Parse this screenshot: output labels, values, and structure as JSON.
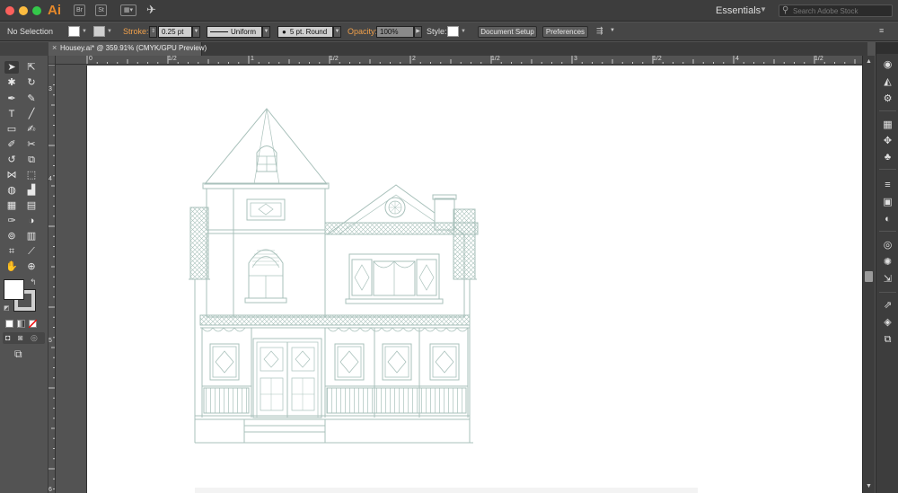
{
  "app": {
    "logo": "Ai",
    "workspace": "Essentials",
    "search_placeholder": "Search Adobe Stock"
  },
  "control_bar": {
    "selection": "No Selection",
    "stroke_label": "Stroke:",
    "stroke_weight": "0.25 pt",
    "profile": "Uniform",
    "brush": "5 pt. Round",
    "opacity_label": "Opacity:",
    "opacity": "100%",
    "style_label": "Style:",
    "document_setup": "Document Setup",
    "preferences": "Preferences"
  },
  "document": {
    "tab_title": "Housey.ai* @ 359.91% (CMYK/GPU Preview)"
  },
  "rulers": {
    "top": [
      "0",
      "1/2",
      "1",
      "1/2",
      "2",
      "1/2",
      "3",
      "1/2",
      "4",
      "1/2"
    ],
    "left": [
      "3",
      "4",
      "5",
      "6"
    ]
  },
  "colors": {
    "accent": "#f0a04b",
    "line_art": "#a9c1bb",
    "artboard": "#ffffff",
    "workspace": "#535353"
  }
}
